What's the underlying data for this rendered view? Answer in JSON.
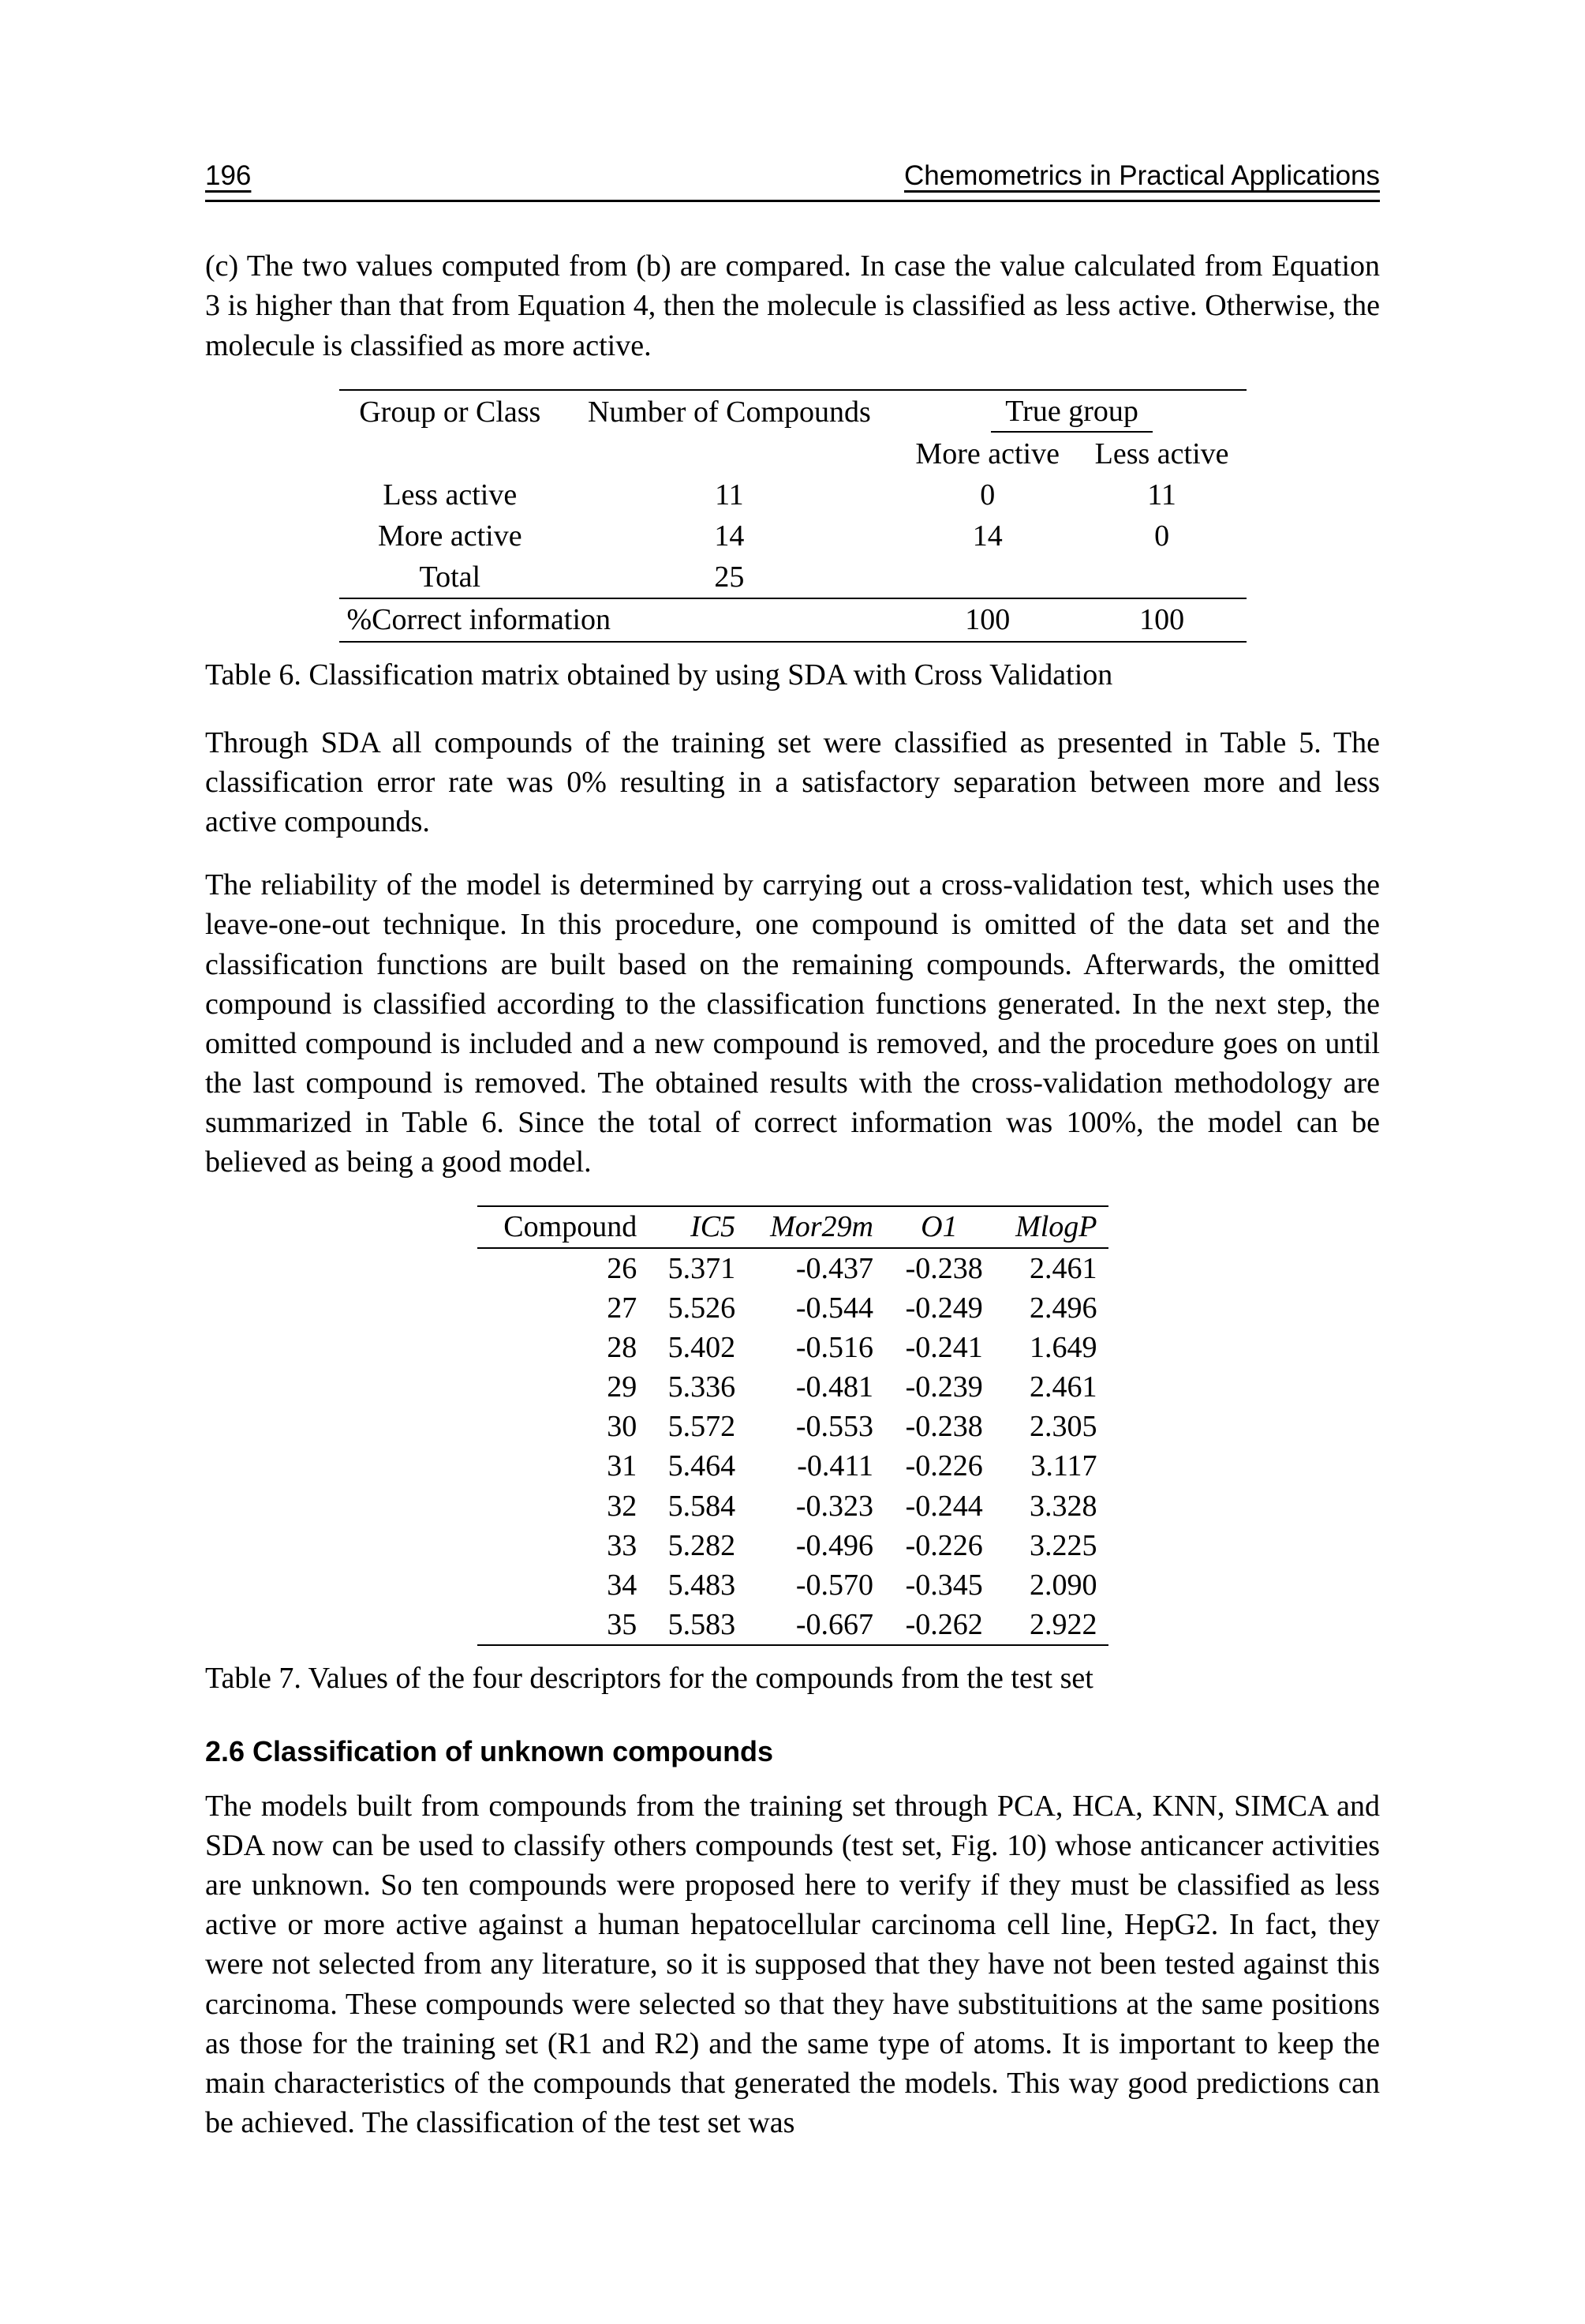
{
  "header": {
    "page_number": "196",
    "title": "Chemometrics in Practical Applications"
  },
  "para_c": "(c) The two values computed from (b) are compared.  In case the value calculated from Equation 3 is higher than that from Equation 4, then the molecule is classified as less active. Otherwise, the molecule is classified as more active.",
  "table6": {
    "caption": "Table 6. Classification matrix obtained by using SDA with Cross Validation",
    "col_group": "Group or Class",
    "col_num": "Number of Compounds",
    "col_true": "True group",
    "col_more": "More active",
    "col_less": "Less active",
    "rows": [
      {
        "g": "Less active",
        "n": "11",
        "ma": "0",
        "la": "11"
      },
      {
        "g": "More active",
        "n": "14",
        "ma": "14",
        "la": "0"
      },
      {
        "g": "Total",
        "n": "25",
        "ma": "",
        "la": ""
      }
    ],
    "correct_label": "%Correct information",
    "correct_ma": "100",
    "correct_la": "100"
  },
  "para_sda": "Through SDA all compounds of the training set were classified as presented in Table 5. The classification error rate was 0% resulting in a satisfactory separation between more and less active compounds.",
  "para_reliab": "The reliability of the model is determined by carrying out a cross-validation test, which uses the leave-one-out technique. In this procedure, one compound is omitted of the data set and the classification functions are built based on the remaining compounds.  Afterwards, the omitted compound is classified according to the classification functions generated. In the next step, the omitted compound is included and a new compound is removed, and the procedure goes on until the last compound is removed.  The obtained results with the cross-validation methodology are summarized in Table 6. Since the total of correct information was 100%, the model can be believed as being a good model.",
  "table7": {
    "caption": "Table 7. Values of the four descriptors for the compounds from the test set",
    "h_compound": "Compound",
    "h_ic5": "IC5",
    "h_mor29m": "Mor29m",
    "h_o1": "O1",
    "h_mlogp": "MlogP",
    "rows": [
      {
        "c": "26",
        "ic5": "5.371",
        "mor": "-0.437",
        "o1": "-0.238",
        "m": "2.461"
      },
      {
        "c": "27",
        "ic5": "5.526",
        "mor": "-0.544",
        "o1": "-0.249",
        "m": "2.496"
      },
      {
        "c": "28",
        "ic5": "5.402",
        "mor": "-0.516",
        "o1": "-0.241",
        "m": "1.649"
      },
      {
        "c": "29",
        "ic5": "5.336",
        "mor": "-0.481",
        "o1": "-0.239",
        "m": "2.461"
      },
      {
        "c": "30",
        "ic5": "5.572",
        "mor": "-0.553",
        "o1": "-0.238",
        "m": "2.305"
      },
      {
        "c": "31",
        "ic5": "5.464",
        "mor": "-0.411",
        "o1": "-0.226",
        "m": "3.117"
      },
      {
        "c": "32",
        "ic5": "5.584",
        "mor": "-0.323",
        "o1": "-0.244",
        "m": "3.328"
      },
      {
        "c": "33",
        "ic5": "5.282",
        "mor": "-0.496",
        "o1": "-0.226",
        "m": "3.225"
      },
      {
        "c": "34",
        "ic5": "5.483",
        "mor": "-0.570",
        "o1": "-0.345",
        "m": "2.090"
      },
      {
        "c": "35",
        "ic5": "5.583",
        "mor": "-0.667",
        "o1": "-0.262",
        "m": "2.922"
      }
    ]
  },
  "section_heading": "2.6 Classification of unknown compounds",
  "para_models": "The models built from compounds from the training set through PCA, HCA, KNN, SIMCA and SDA now can be used to classify others compounds (test set, Fig. 10) whose anticancer activities are unknown.  So ten compounds were proposed here to verify if they must be classified as less active or more active against a human hepatocellular carcinoma cell line, HepG2.  In fact, they were not selected from any literature, so it is supposed that they have not been tested against this carcinoma.  These compounds were selected so that they have substituitions at the same positions as those for the training set (R1 and R2) and the same type of atoms.  It is important to keep the main characteristics of the compounds that generated the models. This way good predictions can be achieved. The classification of the test set was",
  "chart_data": [
    {
      "type": "table",
      "title": "Classification matrix obtained by using SDA with Cross Validation",
      "columns": [
        "Group or Class",
        "Number of Compounds",
        "True group: More active",
        "True group: Less active"
      ],
      "rows": [
        [
          "Less active",
          11,
          0,
          11
        ],
        [
          "More active",
          14,
          14,
          0
        ],
        [
          "Total",
          25,
          null,
          null
        ],
        [
          "%Correct information",
          null,
          100,
          100
        ]
      ]
    },
    {
      "type": "table",
      "title": "Values of the four descriptors for the compounds from the test set",
      "columns": [
        "Compound",
        "IC5",
        "Mor29m",
        "O1",
        "MlogP"
      ],
      "rows": [
        [
          26,
          5.371,
          -0.437,
          -0.238,
          2.461
        ],
        [
          27,
          5.526,
          -0.544,
          -0.249,
          2.496
        ],
        [
          28,
          5.402,
          -0.516,
          -0.241,
          1.649
        ],
        [
          29,
          5.336,
          -0.481,
          -0.239,
          2.461
        ],
        [
          30,
          5.572,
          -0.553,
          -0.238,
          2.305
        ],
        [
          31,
          5.464,
          -0.411,
          -0.226,
          3.117
        ],
        [
          32,
          5.584,
          -0.323,
          -0.244,
          3.328
        ],
        [
          33,
          5.282,
          -0.496,
          -0.226,
          3.225
        ],
        [
          34,
          5.483,
          -0.57,
          -0.345,
          2.09
        ],
        [
          35,
          5.583,
          -0.667,
          -0.262,
          2.922
        ]
      ]
    }
  ]
}
